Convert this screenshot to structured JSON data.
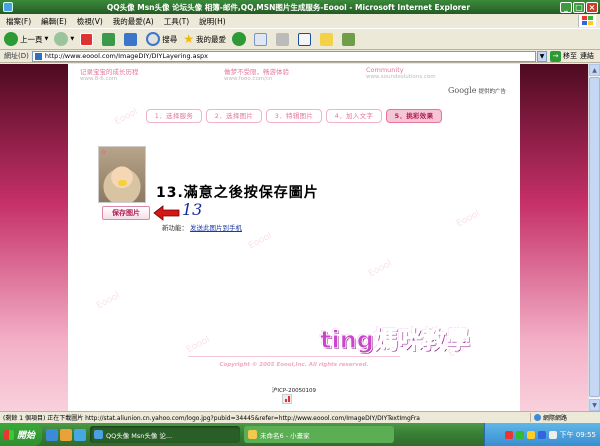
{
  "window": {
    "title": "QQ头像 Msn头像 论坛头像 相簿-邮件,QQ,MSN图片生成服务-Eoool - Microsoft Internet Explorer",
    "titlebar_color": "#2e6e2e"
  },
  "menu": {
    "items": [
      "檔案(F)",
      "編輯(E)",
      "檢視(V)",
      "我的最愛(A)",
      "工具(T)",
      "說明(H)"
    ]
  },
  "toolbar": {
    "back_label": "上一頁",
    "search_label": "搜尋",
    "favorites_label": "我的最愛"
  },
  "address": {
    "label": "網址(D)",
    "url": "http://www.eoool.com/ImageDIY/DIYLayering.aspx",
    "go_label": "移至",
    "links_label": "連結"
  },
  "page": {
    "toplinks": [
      {
        "title": "记录宝宝的成长历程",
        "url": "www.8-6.com"
      },
      {
        "title": "做梦不受限，畅游体验",
        "url": "www.fooo.com/cn"
      },
      {
        "title": "Community",
        "url": "www.soundsolutions.com"
      }
    ],
    "google_label": "Google",
    "google_ad": "提供的广告",
    "steps": [
      {
        "label": "1．选择服务"
      },
      {
        "label": "2．选择图片"
      },
      {
        "label": "3．特辑图片"
      },
      {
        "label": "4．加入文字"
      },
      {
        "label": "5．挑彩效果"
      }
    ],
    "active_step": 4,
    "instruction": "13.滿意之後按保存圖片",
    "save_button": "保存图片",
    "handwritten_number": "13",
    "new_function_label": "新功能：",
    "new_function_link": "发送此图片到手机",
    "signature": "ting媽咪教學",
    "copyright": "Copyright © 2005 Eoool,Inc. All rights reserved.",
    "icp": "沪ICP-20050109",
    "watermark": "Eoool"
  },
  "status": {
    "text": "(剩餘 1 個項目) 正在下載圖片 http://stat.aliunion.cn.yahoo.com/logo.jpg?pubid=34445&refer=http://www.eoool.com/ImageDIY/DIYTextImgFra",
    "zone": "網際網路"
  },
  "taskbar": {
    "start_label": "開始",
    "tasks": [
      {
        "label": "QQ头像 Msn头像 论...",
        "active": true
      },
      {
        "label": "未命名6 - 小畫家",
        "active": false
      }
    ],
    "clock": "下午 09:55"
  },
  "colors": {
    "accent_pink": "#e45b8a",
    "step_text": "#e4769a",
    "active_step_bg": "#f7c6d6",
    "signature": "#cc44cc",
    "handwriting_blue": "#1a2a9a"
  }
}
